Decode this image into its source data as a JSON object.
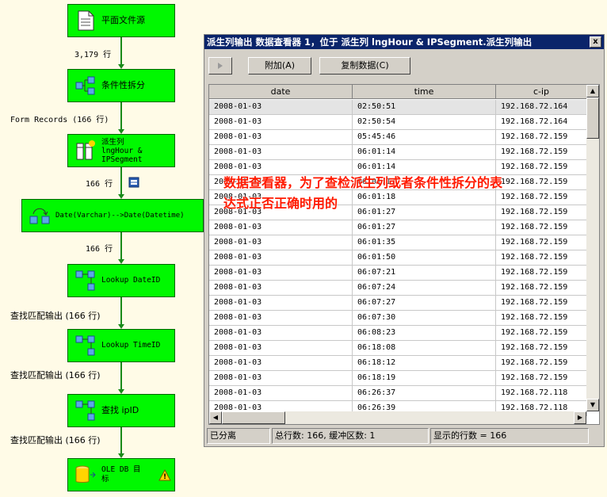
{
  "flow": {
    "nodes": {
      "flat_file": "平面文件源",
      "cond_split": "条件性拆分",
      "derived": "派生列\nlngHour &\nIPSegment",
      "convert": "Date(Varchar)-->Date(Datetime)",
      "lookup_date": "Lookup DateID",
      "lookup_time": "Lookup TimeID",
      "lookup_ip": "查找 ipID",
      "oledb": "OLE DB 目\n标"
    },
    "paths": {
      "p1": "3,179 行",
      "p2": "Form Records (166 行)",
      "p3": "166 行",
      "p4": "166 行",
      "p5": "查找匹配输出 (166 行)",
      "p6": "查找匹配输出 (166 行)",
      "p7": "查找匹配输出 (166 行)"
    }
  },
  "viewer": {
    "title": "派生列输出 数据查看器 1，位于 派生列 lngHour & IPSegment.派生列输出",
    "close": "x",
    "attach": "附加(A)",
    "copy": "复制数据(C)",
    "columns": [
      "date",
      "time",
      "c-ip"
    ],
    "rows": [
      [
        "2008-01-03",
        "02:50:51",
        "192.168.72.164"
      ],
      [
        "2008-01-03",
        "02:50:54",
        "192.168.72.164"
      ],
      [
        "2008-01-03",
        "05:45:46",
        "192.168.72.159"
      ],
      [
        "2008-01-03",
        "06:01:14",
        "192.168.72.159"
      ],
      [
        "2008-01-03",
        "06:01:14",
        "192.168.72.159"
      ],
      [
        "2008-01-03",
        "06:01:17",
        "192.168.72.159"
      ],
      [
        "2008-01-03",
        "06:01:18",
        "192.168.72.159"
      ],
      [
        "2008-01-03",
        "06:01:27",
        "192.168.72.159"
      ],
      [
        "2008-01-03",
        "06:01:27",
        "192.168.72.159"
      ],
      [
        "2008-01-03",
        "06:01:35",
        "192.168.72.159"
      ],
      [
        "2008-01-03",
        "06:01:50",
        "192.168.72.159"
      ],
      [
        "2008-01-03",
        "06:07:21",
        "192.168.72.159"
      ],
      [
        "2008-01-03",
        "06:07:24",
        "192.168.72.159"
      ],
      [
        "2008-01-03",
        "06:07:27",
        "192.168.72.159"
      ],
      [
        "2008-01-03",
        "06:07:30",
        "192.168.72.159"
      ],
      [
        "2008-01-03",
        "06:08:23",
        "192.168.72.159"
      ],
      [
        "2008-01-03",
        "06:18:08",
        "192.168.72.159"
      ],
      [
        "2008-01-03",
        "06:18:12",
        "192.168.72.159"
      ],
      [
        "2008-01-03",
        "06:18:19",
        "192.168.72.159"
      ],
      [
        "2008-01-03",
        "06:26:37",
        "192.168.72.118"
      ],
      [
        "2008-01-03",
        "06:26:39",
        "192.168.72.118"
      ]
    ],
    "status": {
      "detached": "已分离",
      "totals": "总行数: 166, 缓冲区数: 1",
      "shown": "显示的行数 = 166"
    }
  },
  "annotation": "数据查看器，为了查检派生列或者条件性拆分的表达式正否正确时用的"
}
